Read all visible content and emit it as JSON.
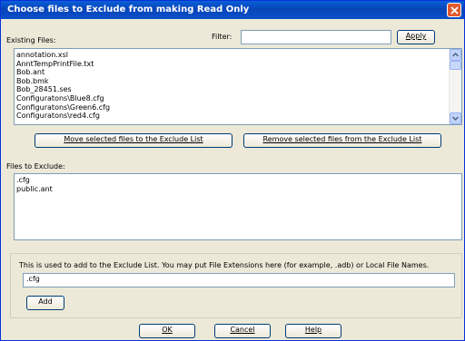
{
  "window": {
    "title": "Choose files to Exclude from making Read Only"
  },
  "existing": {
    "label": "Existing Files:",
    "filter_label": "Filter:",
    "filter_value": "",
    "apply_label": "Apply",
    "files": [
      "annotation.xsl",
      "AnntTempPrintFile.txt",
      "Bob.ant",
      "Bob.bmk",
      "Bob_28451.ses",
      "Configuratons\\Blue8.cfg",
      "Configuratons\\Green6.cfg",
      "Configuratons\\red4.cfg"
    ]
  },
  "buttons": {
    "move_label": "Move selected files to the Exclude List",
    "remove_label": "Remove selected files from the Exclude List"
  },
  "exclude": {
    "label": "Files to Exclude:",
    "files": [
      ".cfg",
      "public.ant"
    ]
  },
  "add_section": {
    "description": "This is used to add to the Exclude List.  You may put File Extensions here (for example, .adb) or Local File Names.",
    "input_value": ".cfg",
    "add_label": "Add"
  },
  "footer": {
    "ok_label": "OK",
    "cancel_label": "Cancel",
    "help_label": "Help"
  },
  "colors": {
    "titlebar": "#0a4fc9",
    "close": "#e0592f",
    "dialog_bg": "#ece9d8"
  },
  "icons": {
    "close": "close-icon",
    "scroll_up": "scroll-up-arrow-icon",
    "scroll_down": "scroll-down-arrow-icon"
  }
}
